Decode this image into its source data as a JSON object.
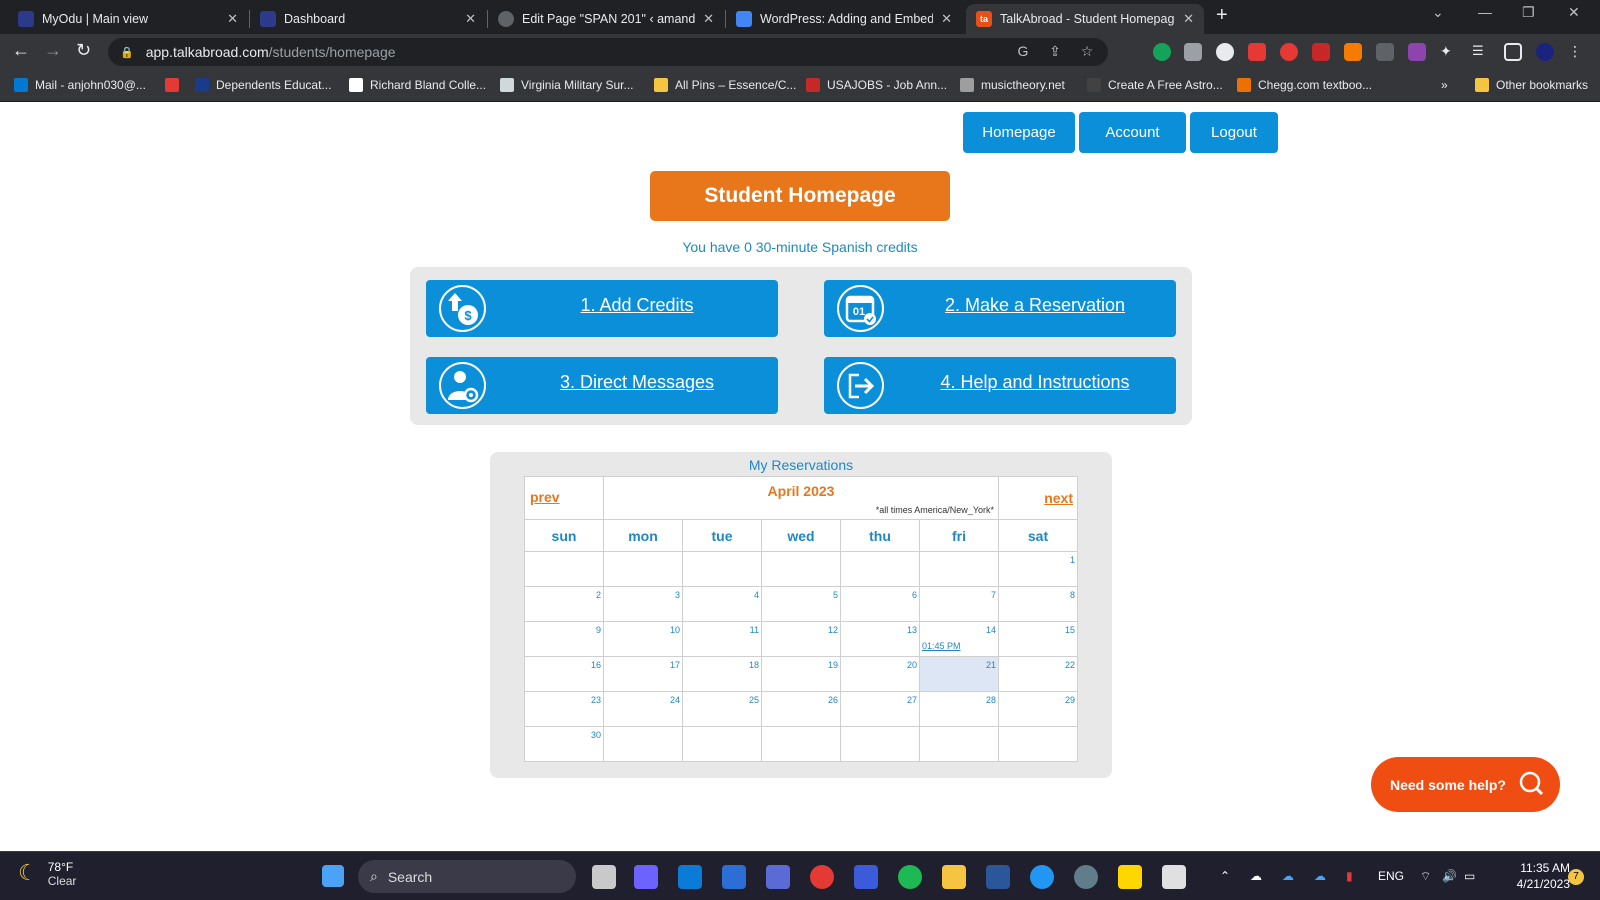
{
  "browser": {
    "tabs": [
      {
        "title": "MyOdu | Main view",
        "fav_color": "#2b3a8a",
        "fav_text": ""
      },
      {
        "title": "Dashboard",
        "fav_color": "#2b3a8a",
        "fav_text": ""
      },
      {
        "title": "Edit Page \"SPAN 201\" ‹ amandaj",
        "fav_color": "#5f6368",
        "fav_text": ""
      },
      {
        "title": "WordPress: Adding and Embedd",
        "fav_color": "#4285f4",
        "fav_text": ""
      },
      {
        "title": "TalkAbroad - Student Homepage",
        "fav_color": "#e8501a",
        "fav_text": "ta"
      }
    ],
    "url_host": "app.talkabroad.com",
    "url_path": "/students/homepage",
    "bookmarks": [
      {
        "label": "Mail - anjohn030@...",
        "color": "#0078d4"
      },
      {
        "label": "Dependents Educat...",
        "color": "#1a3a8a"
      },
      {
        "label": "Richard Bland Colle...",
        "color": "#ffffff"
      },
      {
        "label": "Virginia Military Sur...",
        "color": "#cfd8dc"
      },
      {
        "label": "All Pins – Essence/C...",
        "color": "#f5c542"
      },
      {
        "label": "USAJOBS - Job Ann...",
        "color": "#c62828"
      },
      {
        "label": "musictheory.net",
        "color": "#9e9e9e"
      },
      {
        "label": "Create A Free Astro...",
        "color": "#424242"
      },
      {
        "label": "Chegg.com textboo...",
        "color": "#eb7100"
      }
    ],
    "other_bookmarks": "Other bookmarks"
  },
  "nav": {
    "homepage": "Homepage",
    "account": "Account",
    "logout": "Logout"
  },
  "title": "Student Homepage",
  "credits_text": "You have 0 30-minute Spanish credits",
  "actions": [
    {
      "label": "1. Add Credits",
      "icon": "add-credits-icon"
    },
    {
      "label": "2. Make a Reservation",
      "icon": "calendar-check-icon"
    },
    {
      "label": "3. Direct Messages",
      "icon": "user-gear-icon"
    },
    {
      "label": "4. Help and Instructions",
      "icon": "arrow-right-box-icon"
    }
  ],
  "reservations": {
    "title": "My Reservations",
    "prev": "prev",
    "next": "next",
    "month": "April 2023",
    "timezone_note": "*all times America/New_York*",
    "weekdays": [
      "sun",
      "mon",
      "tue",
      "wed",
      "thu",
      "fri",
      "sat"
    ],
    "weeks": [
      [
        "",
        "",
        "",
        "",
        "",
        "",
        "1"
      ],
      [
        "2",
        "3",
        "4",
        "5",
        "6",
        "7",
        "8"
      ],
      [
        "9",
        "10",
        "11",
        "12",
        "13",
        "14",
        "15"
      ],
      [
        "16",
        "17",
        "18",
        "19",
        "20",
        "21",
        "22"
      ],
      [
        "23",
        "24",
        "25",
        "26",
        "27",
        "28",
        "29"
      ],
      [
        "30",
        "",
        "",
        "",
        "",
        "",
        ""
      ]
    ],
    "appointment": {
      "day": "14",
      "time": "01:45 PM"
    },
    "today": "21"
  },
  "help_button": "Need some help?",
  "taskbar": {
    "temp": "78°F",
    "condition": "Clear",
    "search": "Search",
    "lang": "ENG",
    "time": "11:35 AM",
    "date": "4/21/2023",
    "notifications": "7"
  }
}
